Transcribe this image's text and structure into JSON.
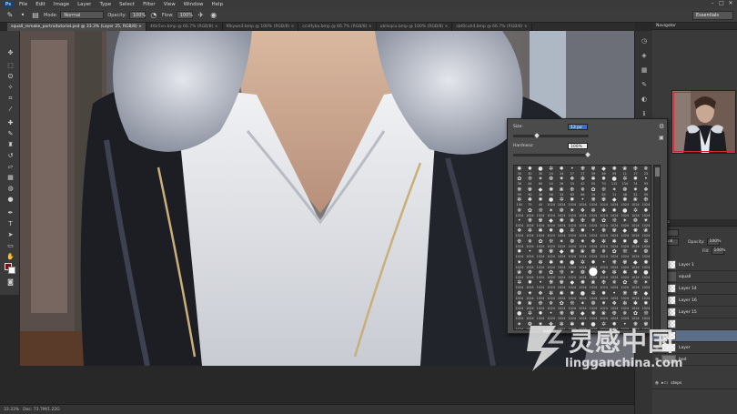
{
  "app": {
    "logo": "Ps"
  },
  "menu": [
    "File",
    "Edit",
    "Image",
    "Layer",
    "Type",
    "Select",
    "Filter",
    "View",
    "Window",
    "Help"
  ],
  "window_controls": [
    "–",
    "□",
    "✕"
  ],
  "options": {
    "mode_label": "Mode:",
    "mode_value": "Normal",
    "opacity_label": "Opacity:",
    "opacity_value": "100%",
    "flow_label": "Flow:",
    "flow_value": "100%",
    "workspace": "Essentials"
  },
  "tabs": [
    {
      "label": "squall_remake_portraitutorial.psd @ 33.3% (Layer 25, RGB/8) ×",
      "active": true
    },
    {
      "label": "4l6r5vn.bmp @ 66.7% (RGB/8) ×",
      "active": false
    },
    {
      "label": "f0kywe3.bmp @ 100% (RGB/8) ×",
      "active": false
    },
    {
      "label": "ccidfyba.bmp @ 66.7% (RGB/8) ×",
      "active": false
    },
    {
      "label": "ublisqcu.bmp @ 100% (RGB/8) ×",
      "active": false
    },
    {
      "label": "sbt0cuh4.bmp @ 66.7% (RGB/8) ×",
      "active": false
    }
  ],
  "status": {
    "zoom": "33.33%",
    "doc": "Doc: 73.7M/1.22G"
  },
  "panels": {
    "navigator": "Navigator",
    "layers": "Layers",
    "opacity_label": "Opacity:",
    "opacity_value": "100%",
    "fill_label": "Fill:",
    "fill_value": "100%",
    "layers_list": [
      {
        "name": "Layer 1",
        "selected": false
      },
      {
        "name": "squall",
        "selected": false
      },
      {
        "name": "Layer 14",
        "selected": false
      },
      {
        "name": "Layer 16",
        "selected": false
      },
      {
        "name": "Layer 15",
        "selected": false
      },
      {
        "name": "",
        "selected": false
      },
      {
        "name": "",
        "selected": true
      },
      {
        "name": "Layer",
        "selected": false
      },
      {
        "name": "bod",
        "selected": false
      },
      {
        "name": "steps",
        "selected": false
      }
    ]
  },
  "brush_picker": {
    "size_label": "Size:",
    "size_value": "13 px",
    "hardness_label": "Hardness:",
    "hardness_value": "100%",
    "size_level": 0.3,
    "hardness_level": 1.0,
    "presets": [
      [
        "",
        "",
        "",
        "",
        "",
        "",
        "",
        "",
        "",
        "",
        "",
        "",
        ""
      ],
      [
        "",
        "",
        "",
        "",
        "",
        "",
        "",
        "",
        "",
        "",
        "",
        "",
        ""
      ],
      [
        "",
        "",
        "",
        "",
        "",
        "",
        "",
        "",
        "",
        "",
        "",
        "",
        ""
      ],
      [
        "",
        "",
        "",
        "",
        "",
        "",
        "",
        "",
        "",
        "",
        "",
        "",
        ""
      ],
      [
        "",
        "",
        "",
        "",
        "",
        "",
        "",
        "",
        "",
        "",
        "",
        "",
        ""
      ],
      [
        "",
        "",
        "",
        "",
        "",
        "",
        "",
        "",
        "",
        "",
        "",
        "",
        ""
      ],
      [
        "",
        "",
        "",
        "",
        "",
        "",
        "",
        "",
        "",
        "",
        "",
        "",
        ""
      ],
      [
        "",
        "",
        "",
        "",
        "",
        "",
        "",
        "",
        "",
        "",
        "",
        "",
        ""
      ],
      [
        "",
        "",
        "",
        "",
        "",
        "",
        "",
        "",
        "",
        "",
        "",
        "",
        ""
      ],
      [
        "",
        "",
        "",
        "",
        "",
        "",
        "",
        "",
        "",
        "",
        "",
        "",
        ""
      ],
      [
        "",
        "",
        "",
        "",
        "",
        "",
        "",
        "",
        "",
        "",
        "",
        "",
        ""
      ],
      [
        "",
        "",
        "",
        "",
        "",
        "",
        "",
        "",
        "",
        "",
        "",
        "",
        ""
      ],
      [
        "",
        "",
        "",
        "",
        "",
        "",
        "",
        "",
        "",
        "",
        "",
        "",
        ""
      ],
      [
        "",
        "",
        "",
        "",
        "",
        "",
        "",
        "",
        "",
        "",
        "",
        "",
        ""
      ],
      [
        "",
        "",
        "",
        "",
        "",
        "",
        "",
        "",
        "",
        "",
        "",
        "",
        ""
      ],
      [
        "",
        "",
        "",
        "",
        "",
        "",
        "",
        "",
        "",
        "",
        "",
        "",
        ""
      ]
    ],
    "preset_numbers": [
      "30",
      "30",
      "30",
      "14",
      "24",
      "27",
      "27",
      "39",
      "46",
      "59",
      "11",
      "17",
      "23",
      "36",
      "44",
      "60",
      "14",
      "26",
      "33",
      "42",
      "55",
      "70",
      "112",
      "134",
      "74",
      "95",
      "95",
      "90",
      "36",
      "36",
      "33",
      "63",
      "66",
      "39",
      "63",
      "11",
      "48",
      "32",
      "55",
      "100",
      "75",
      "45",
      "1024",
      "1024",
      "1024",
      "1024",
      "1024",
      "1024",
      "1024",
      "1024",
      "1024",
      "1024",
      "1024",
      "1024",
      "1024",
      "1024",
      "1024",
      "1024",
      "1024",
      "1024",
      "1024",
      "1024",
      "1024",
      "1024",
      "1024",
      "1024",
      "1024",
      "1024",
      "1024",
      "1024",
      "1024",
      "1024",
      "1024",
      "1024",
      "1024",
      "1024",
      "1024",
      "1024",
      "1024",
      "1024",
      "1024",
      "1024",
      "1024",
      "1024",
      "1024",
      "1024",
      "1024",
      "1024",
      "1024",
      "1024",
      "1024",
      "1024",
      "1024",
      "1024",
      "1024",
      "1024",
      "1024",
      "1024",
      "1024",
      "1024",
      "1024",
      "1024",
      "1024",
      "1024",
      "1024",
      "1024",
      "1024",
      "1024",
      "1024",
      "1024",
      "1024",
      "1024",
      "1024",
      "1024",
      "1024",
      "1024",
      "1024",
      "1024",
      "1024",
      "1024",
      "1024",
      "1024",
      "1024",
      "1024",
      "1024",
      "1024",
      "1024",
      "1024",
      "1024",
      "1024",
      "1024",
      "1024",
      "1024",
      "1024",
      "1024",
      "1024",
      "1024",
      "1024",
      "1024",
      "1024",
      "1024",
      "1024",
      "1024",
      "1024",
      "1024",
      "1024",
      "1024",
      "1024",
      "1024",
      "1024",
      "1024",
      "1024",
      "1024",
      "1024",
      "1024",
      "1024",
      "1024",
      "1024",
      "1024",
      "1024",
      "1024",
      "1024",
      "1024",
      "1024",
      "1024",
      "1024",
      "1024",
      "1024",
      "1024",
      "1024",
      "1024",
      "1024",
      "1024",
      "1024",
      "1024",
      "1024",
      "1024",
      "1024",
      "1024",
      "1024",
      "1024",
      "1024",
      "1024",
      "1024",
      "1024",
      "1024",
      "1024",
      "1024",
      "1024",
      "1024",
      "1024",
      "1024",
      "1024",
      "1024",
      "1024",
      "1024",
      "1024",
      "1024",
      "1024",
      "1024",
      "1024",
      "1024",
      "1024",
      "1024",
      "1024",
      "1024",
      "1024",
      "1024",
      "1024",
      "1024",
      "1024"
    ]
  },
  "watermark": {
    "text": "灵感中国",
    "url": "lingganchina.com"
  },
  "colors": {
    "foreground": "#7a1414",
    "background": "#fafafa",
    "selection": "#5a6e87"
  }
}
